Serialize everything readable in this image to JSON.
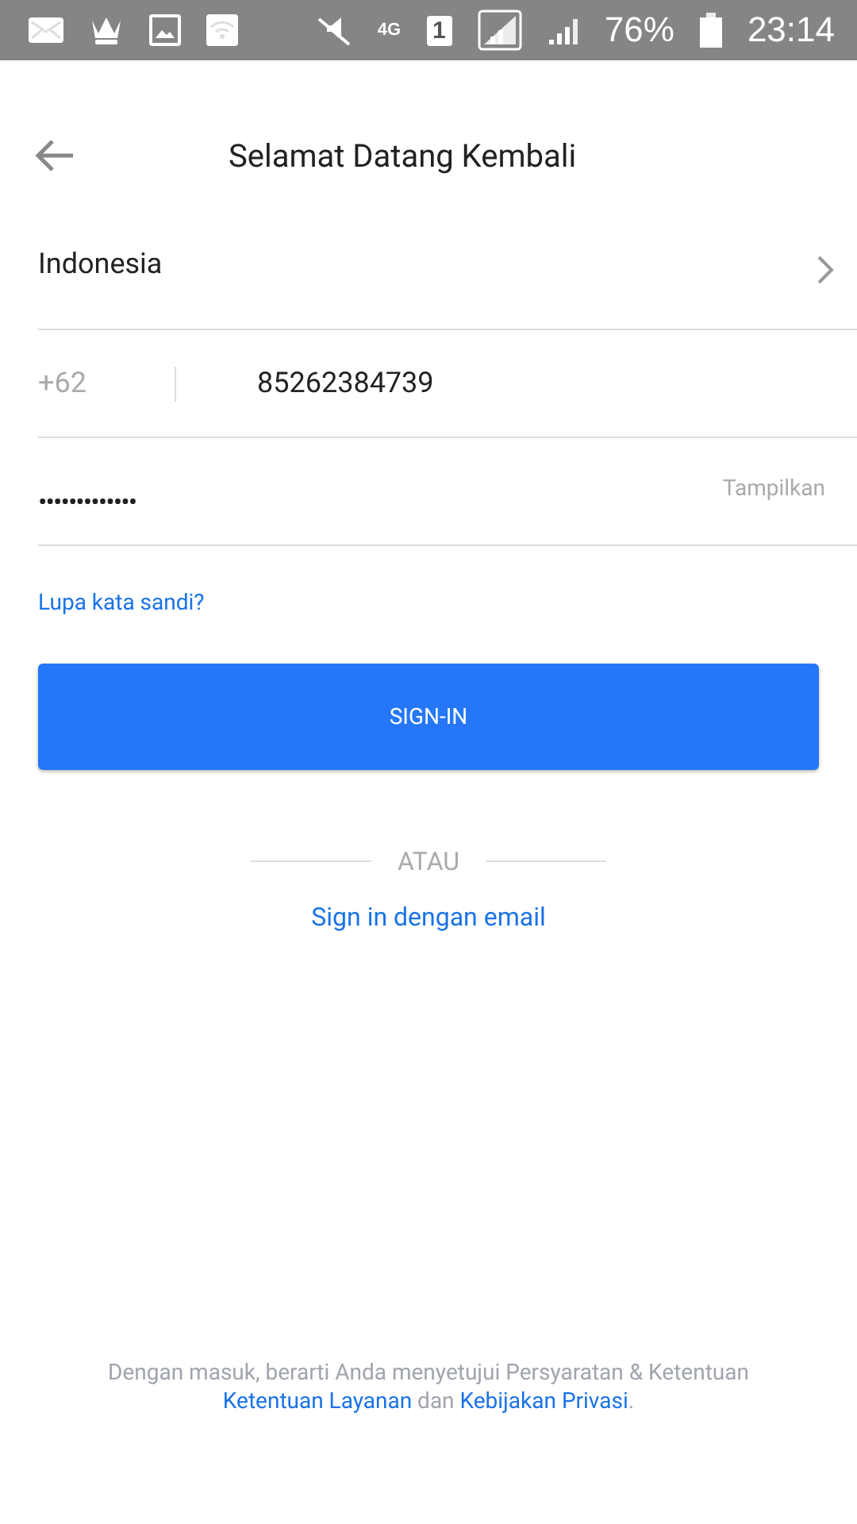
{
  "status_bar": {
    "network": "4G",
    "sim": "1",
    "battery": "76%",
    "time": "23:14"
  },
  "header": {
    "title": "Selamat Datang Kembali"
  },
  "country": {
    "value": "Indonesia"
  },
  "phone": {
    "code": "+62",
    "value": "85262384739"
  },
  "password": {
    "value": "•••••••••••••",
    "toggle": "Tampilkan"
  },
  "forgot_link": "Lupa kata sandi?",
  "sign_in_button": "SIGN-IN",
  "divider": "ATAU",
  "email_link": "Sign in dengan email",
  "footer": {
    "text": "Dengan masuk, berarti Anda menyetujui Persyaratan & Ketentuan",
    "terms_link": "Ketentuan Layanan",
    "joiner": "dan",
    "privacy_link": "Kebijakan Privasi",
    "end": "."
  }
}
